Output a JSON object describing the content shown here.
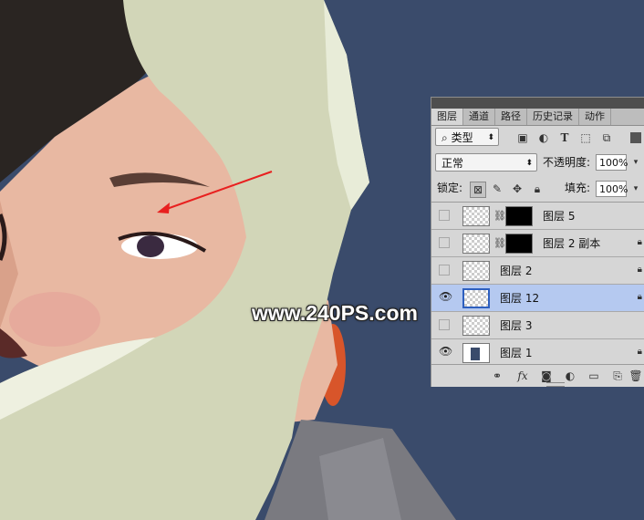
{
  "watermark": "www.240PS.com",
  "panel": {
    "tabs": [
      "图层",
      "通道",
      "路径",
      "历史记录",
      "动作"
    ],
    "filter_kind": "类型",
    "blend_mode": "正常",
    "opacity_label": "不透明度:",
    "opacity_value": "100%",
    "lock_label": "锁定:",
    "fill_label": "填充:",
    "fill_value": "100%",
    "layers": [
      {
        "name": "图层 5",
        "visible": false,
        "has_mask": true,
        "locked": false,
        "selected": false
      },
      {
        "name": "图层 2 副本",
        "visible": false,
        "has_mask": true,
        "locked": true,
        "selected": false
      },
      {
        "name": "图层 2",
        "visible": false,
        "has_mask": false,
        "locked": true,
        "selected": false
      },
      {
        "name": "图层 12",
        "visible": true,
        "has_mask": false,
        "locked": true,
        "selected": true
      },
      {
        "name": "图层 3",
        "visible": false,
        "has_mask": false,
        "locked": false,
        "selected": false
      },
      {
        "name": "图层 1",
        "visible": true,
        "has_mask": false,
        "locked": true,
        "selected": false
      }
    ],
    "icons": {
      "filter_image": "image-filter-icon",
      "filter_adjust": "adjustment-filter-icon",
      "filter_text": "text-filter-icon",
      "filter_shape": "shape-filter-icon",
      "filter_smart": "smart-object-filter-icon",
      "lock_pixels": "lock-transparent-icon",
      "lock_paint": "lock-paint-icon",
      "lock_move": "lock-move-icon",
      "lock_all": "lock-all-icon"
    },
    "bottom_icons": [
      "link-icon",
      "fx-icon",
      "mask-icon",
      "adjustment-icon",
      "folder-icon",
      "new-layer-icon",
      "trash-icon"
    ]
  },
  "colors": {
    "background": "#3a4b6b",
    "selected_layer": "#b5c9f0",
    "arrow": "#e8201f"
  }
}
